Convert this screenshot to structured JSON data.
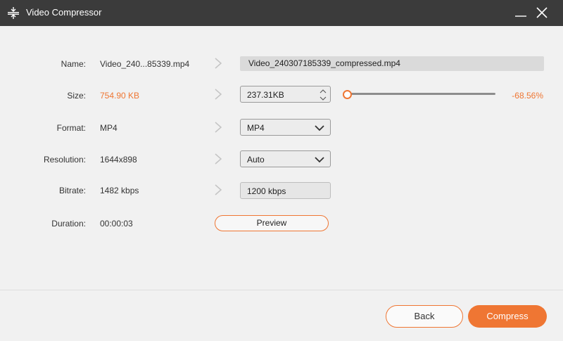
{
  "window": {
    "title": "Video Compressor"
  },
  "colors": {
    "accent": "#ef7633",
    "titlebar": "#3b3b3b",
    "background": "#f1f1f1"
  },
  "labels": {
    "name": "Name:",
    "size": "Size:",
    "format": "Format:",
    "resolution": "Resolution:",
    "bitrate": "Bitrate:",
    "duration": "Duration:"
  },
  "source": {
    "name": "Video_240...85339.mp4",
    "size": "754.90 KB",
    "format": "MP4",
    "resolution": "1644x898",
    "bitrate": "1482 kbps",
    "duration": "00:00:03"
  },
  "output": {
    "name": "Video_240307185339_compressed.mp4",
    "size": "237.31KB",
    "format": "MP4",
    "resolution": "Auto",
    "bitrate": "1200 kbps",
    "size_reduction": "-68.56%",
    "slider_position_fraction": 0.0
  },
  "buttons": {
    "preview": "Preview",
    "back": "Back",
    "compress": "Compress"
  },
  "icons": {
    "app": "compress-icon",
    "minimize": "minimize-icon",
    "close": "close-icon",
    "arrow": "chevron-right-icon",
    "spin_up": "spin-up-icon",
    "spin_down": "spin-down-icon",
    "dropdown": "chevron-down-icon"
  }
}
